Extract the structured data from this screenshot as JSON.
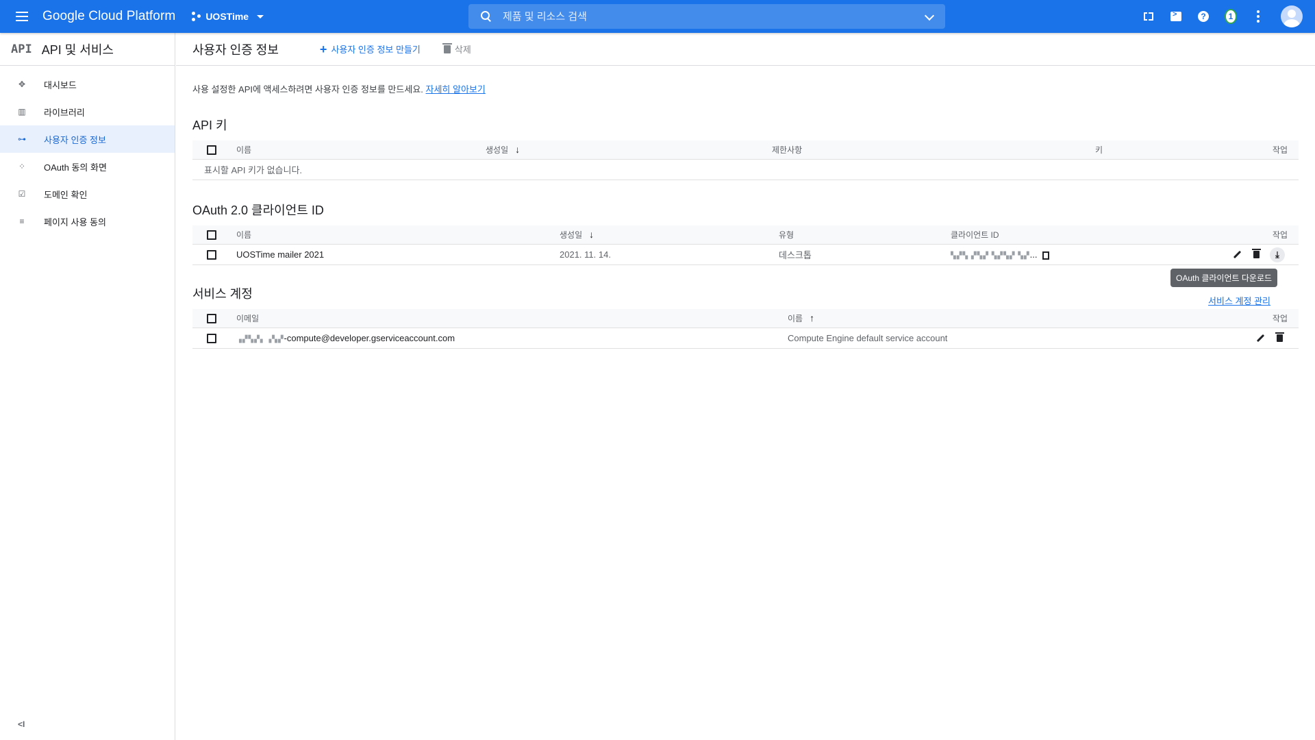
{
  "topbar": {
    "brand": "Google Cloud Platform",
    "project": "UOSTime",
    "search_placeholder": "제품 및 리소스 검색",
    "notification_count": "1"
  },
  "sidebar": {
    "logo": "API",
    "title": "API 및 서비스",
    "items": [
      {
        "label": "대시보드",
        "icon": "dashboard-icon"
      },
      {
        "label": "라이브러리",
        "icon": "library-icon"
      },
      {
        "label": "사용자 인증 정보",
        "icon": "key-icon",
        "active": true
      },
      {
        "label": "OAuth 동의 화면",
        "icon": "consent-icon"
      },
      {
        "label": "도메인 확인",
        "icon": "domain-check-icon"
      },
      {
        "label": "페이지 사용 동의",
        "icon": "page-agreement-icon"
      }
    ],
    "collapse": "<I"
  },
  "main": {
    "title": "사용자 인증 정보",
    "create_label": "사용자 인증 정보 만들기",
    "delete_label": "삭제",
    "intro_text": "사용 설정한 API에 액세스하려면 사용자 인증 정보를 만드세요.",
    "intro_link": "자세히 알아보기"
  },
  "api_keys": {
    "title": "API 키",
    "headers": {
      "name": "이름",
      "created": "생성일",
      "restrictions": "제한사항",
      "key": "키",
      "actions": "작업"
    },
    "empty": "표시할 API 키가 없습니다."
  },
  "oauth": {
    "title": "OAuth 2.0 클라이언트 ID",
    "headers": {
      "name": "이름",
      "created": "생성일",
      "type": "유형",
      "client_id": "클라이언트 ID",
      "actions": "작업"
    },
    "rows": [
      {
        "name": "UOSTime mailer 2021",
        "created": "2021. 11. 14.",
        "type": "데스크톱",
        "client_id_tail": "..."
      }
    ],
    "tooltip": "OAuth 클라이언트 다운로드"
  },
  "service_accounts": {
    "title": "서비스 계정",
    "manage_link": "서비스 계정 관리",
    "headers": {
      "email": "이메일",
      "name": "이름",
      "actions": "작업"
    },
    "rows": [
      {
        "email": "-compute@developer.gserviceaccount.com",
        "name": "Compute Engine default service account"
      }
    ]
  },
  "colors": {
    "accent": "#1a73e8",
    "active_bg": "#e8f0fe"
  }
}
